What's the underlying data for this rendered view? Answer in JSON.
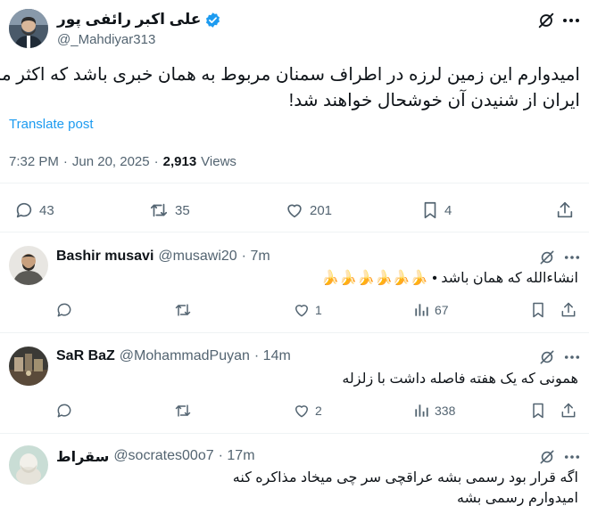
{
  "main_post": {
    "author_name": "علی اکبر رائفی پور",
    "handle": "@_Mahdiyar313",
    "text_line1": "امیدوارم این زمین لرزه در اطراف سمنان مربوط به همان خبری باشد که اکثر مردم",
    "text_line2": "ایران از شنیدن آن خوشحال خواهند شد!",
    "translate_label": "Translate post",
    "time": "7:32 PM",
    "separator": "·",
    "date": "Jun 20, 2025",
    "views_count": "2,913",
    "views_label": "Views",
    "replies": "43",
    "reposts": "35",
    "likes": "201",
    "bookmarks": "4"
  },
  "replies": [
    {
      "name": "Bashir musavi",
      "handle": "@musawi20",
      "time": "· 7m",
      "text": "انشاءالله که همان باشد • 🍌🍌🍌🍌🍌🍌",
      "replies": "",
      "reposts": "",
      "likes": "1",
      "views": "67"
    },
    {
      "name": "SaR BaZ",
      "handle": "@MohammadPuyan",
      "time": "· 14m",
      "text": "همونی که یک هفته فاصله داشت با زلزله",
      "replies": "",
      "reposts": "",
      "likes": "2",
      "views": "338"
    },
    {
      "name": "سقراط",
      "handle": "@socrates00o7",
      "time": "· 17m",
      "text_line1": "اگه قرار بود رسمی بشه عراقچی سر چی میخاد مذاکره کنه",
      "text_line2": "امیدوارم رسمی بشه"
    }
  ],
  "colors": {
    "accent": "#1d9bf0",
    "text": "#0f1419",
    "muted": "#536471",
    "divider": "#eff3f4",
    "banana": "#f5c518"
  },
  "icons": {
    "verified": "verified-badge-icon",
    "grok": "grok-icon",
    "more": "more-dots-icon",
    "reply": "reply-icon",
    "repost": "repost-icon",
    "like": "heart-icon",
    "bookmark": "bookmark-icon",
    "share": "share-icon",
    "views": "views-bar-icon"
  }
}
